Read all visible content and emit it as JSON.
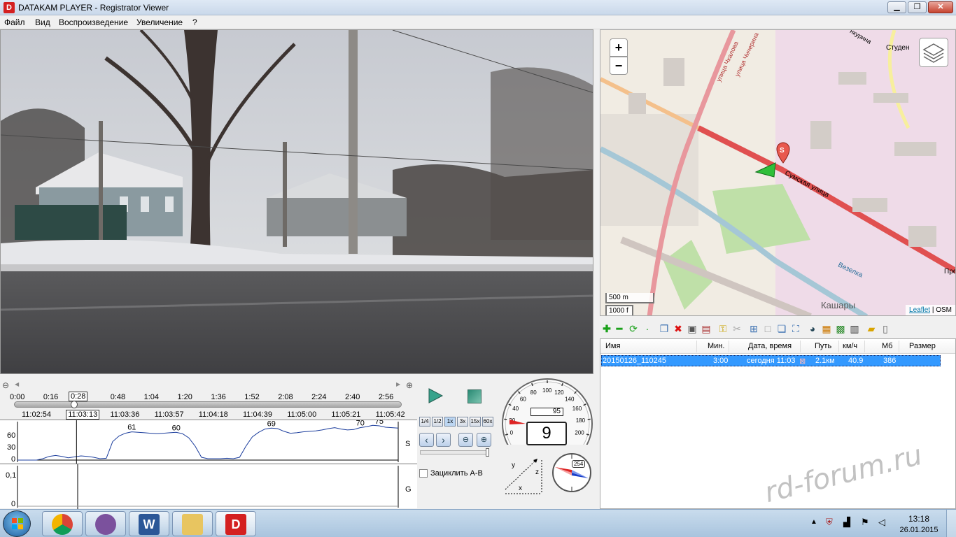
{
  "window": {
    "title": "DATAKAM PLAYER - Registrator Viewer",
    "app_icon_letter": "D"
  },
  "menu": [
    "Файл",
    "Вид",
    "Воспроизведение",
    "Увеличение",
    "?"
  ],
  "map": {
    "zoom_in": "+",
    "zoom_out": "−",
    "scale_metric": "500 m",
    "scale_imperial": "1000 f",
    "attribution_link": "Leaflet",
    "attribution_sep": " | ",
    "attribution_source": "OSM",
    "marker_letter": "S",
    "labels": {
      "street_main": "Сумская улица",
      "street_upper": "улица Чкалова",
      "street_upper2": "улица Чичерина",
      "street_ne": "Студен",
      "street_ne2": "нкурина",
      "river": "Везелка",
      "district": "Кашары",
      "edge_right": "Пре"
    }
  },
  "filelist": {
    "headers": [
      "Имя",
      "Мин.",
      "Дата, время",
      "Путь",
      "км/ч",
      "Мб",
      "Размер"
    ],
    "row": {
      "name": "20150126_110245",
      "minutes": "3:00",
      "datetime": "сегодня 11:03",
      "path": "2.1км",
      "speed": "40.9",
      "mb": "386"
    }
  },
  "timeline": {
    "ticks": [
      "0:00",
      "0:16",
      "0:28",
      "0:48",
      "1:04",
      "1:20",
      "1:36",
      "1:52",
      "2:08",
      "2:24",
      "2:40",
      "2:56"
    ],
    "current_tick_index": 2,
    "clock": [
      "11:02:54",
      "11:03:13",
      "11:03:36",
      "11:03:57",
      "11:04:18",
      "11:04:39",
      "11:05:00",
      "11:05:21",
      "11:05:42"
    ],
    "current_clock_index": 1,
    "position_fraction": 0.155
  },
  "graph_speed": {
    "y_ticks": [
      "60",
      "30",
      "0"
    ],
    "side_label": "S",
    "peaks": [
      "61",
      "60",
      "69",
      "70",
      "75"
    ],
    "values": [
      0,
      0,
      0,
      0,
      3,
      8,
      10,
      8,
      5,
      7,
      9,
      8,
      6,
      3,
      4,
      40,
      52,
      58,
      61,
      60,
      59,
      58,
      57,
      58,
      59,
      60,
      57,
      48,
      30,
      6,
      3,
      3,
      3,
      4,
      3,
      6,
      30,
      50,
      60,
      67,
      69,
      68,
      62,
      58,
      59,
      61,
      62,
      63,
      65,
      68,
      70,
      67,
      65,
      66,
      70,
      72,
      75,
      74,
      71,
      70,
      69
    ],
    "y_max": 80
  },
  "graph_g": {
    "y_ticks": [
      "0,1",
      "0"
    ],
    "side_label": "G"
  },
  "controls": {
    "speeds": [
      "1/4",
      "1/2",
      "1x",
      "3x",
      "15x",
      "60x"
    ],
    "loop_label": "Зациклить А-В"
  },
  "speedometer": {
    "value": "9",
    "odometer": "95",
    "scale": [
      "0",
      "20",
      "40",
      "60",
      "80",
      "100",
      "120",
      "140",
      "160",
      "180",
      "200"
    ],
    "max": 200
  },
  "accel": {
    "x": "x",
    "y": "y",
    "z": "z"
  },
  "compass": {
    "heading": "254"
  },
  "taskbar": {
    "time": "13:18",
    "date": "26.01.2015"
  },
  "watermark": "rd-forum.ru",
  "colors": {
    "accent": "#3399ff",
    "route": "#e05050",
    "titlebar": "#c9d8ea"
  }
}
